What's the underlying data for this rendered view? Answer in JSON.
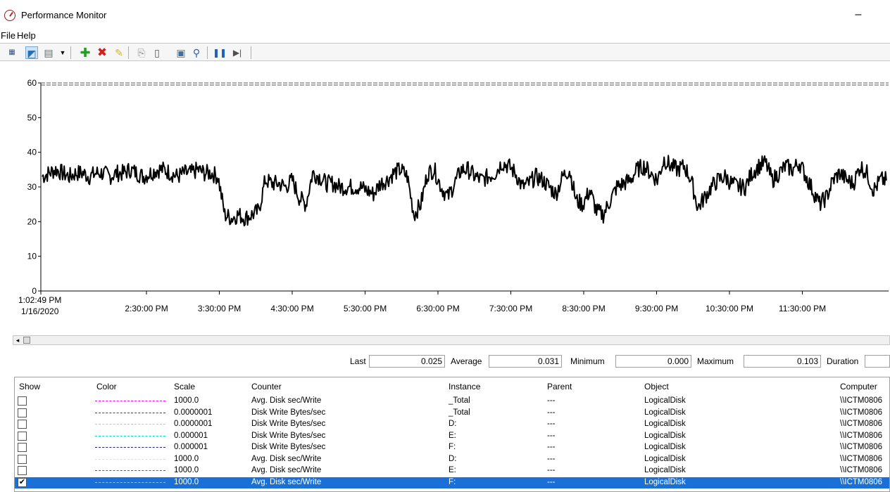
{
  "window": {
    "title": "Performance Monitor",
    "minimize_glyph": "–"
  },
  "menu": [
    "File",
    "Help"
  ],
  "toolbar": {
    "icons": [
      "view-graph-icon",
      "change-graph-type-icon",
      "chart-dropdown-icon",
      "add-counter-icon",
      "delete-counter-icon",
      "highlight-icon",
      "copy-properties-icon",
      "paste-counter-list-icon",
      "properties-icon",
      "zoom-icon",
      "freeze-display-icon",
      "update-data-icon"
    ]
  },
  "chart_data": {
    "type": "line",
    "ylim": [
      0,
      60
    ],
    "yticks": [
      "0",
      "10",
      "20",
      "30",
      "40",
      "50",
      "60"
    ],
    "xticks": [
      {
        "label": "1:02:49 PM",
        "sub": "1/16/2020"
      },
      {
        "label": "2:30:00 PM"
      },
      {
        "label": "3:30:00 PM"
      },
      {
        "label": "4:30:00 PM"
      },
      {
        "label": "5:30:00 PM"
      },
      {
        "label": "6:30:00 PM"
      },
      {
        "label": "7:30:00 PM"
      },
      {
        "label": "8:30:00 PM"
      },
      {
        "label": "9:30:00 PM"
      },
      {
        "label": "10:30:00 PM"
      },
      {
        "label": "11:30:00 PM"
      }
    ],
    "series": [
      {
        "color": "#000000",
        "values": [
          33,
          34,
          35,
          34,
          33,
          34,
          34,
          33,
          34,
          34,
          33,
          34,
          34,
          35,
          34,
          33,
          34,
          35,
          35,
          34,
          33,
          34,
          34,
          35,
          34,
          34,
          33,
          22,
          21,
          22,
          21,
          22,
          23,
          32,
          31,
          31,
          30,
          32,
          27,
          25,
          34,
          33,
          31,
          31,
          30,
          30,
          30,
          30,
          29,
          28,
          31,
          32,
          34,
          35,
          33,
          22,
          25,
          34,
          35,
          30,
          27,
          31,
          35,
          35,
          33,
          32,
          33,
          34,
          37,
          36,
          34,
          30,
          31,
          33,
          32,
          30,
          28,
          33,
          35,
          26,
          25,
          29,
          23,
          22,
          26,
          30,
          31,
          32,
          35,
          36,
          34,
          32,
          38,
          36,
          35,
          36,
          32,
          24,
          27,
          30,
          32,
          33,
          31,
          30,
          30,
          34,
          36,
          37,
          32,
          34,
          36,
          35,
          37,
          33,
          29,
          25,
          27,
          32,
          34,
          32,
          31,
          36,
          34,
          29,
          32
        ]
      }
    ]
  },
  "stats": {
    "last_label": "Last",
    "last_value": "0.025",
    "average_label": "Average",
    "average_value": "0.031",
    "minimum_label": "Minimum",
    "minimum_value": "0.000",
    "maximum_label": "Maximum",
    "maximum_value": "0.103",
    "duration_label": "Duration"
  },
  "legend": {
    "headers": {
      "show": "Show",
      "color": "Color",
      "scale": "Scale",
      "counter": "Counter",
      "instance": "Instance",
      "parent": "Parent",
      "object": "Object",
      "computer": "Computer"
    },
    "rows": [
      {
        "checked": false,
        "color": "#ff00ff",
        "scale": "1000.0",
        "counter": "Avg. Disk sec/Write",
        "instance": "_Total",
        "parent": "---",
        "object": "LogicalDisk",
        "computer": "\\\\ICTM0806"
      },
      {
        "checked": false,
        "color": "#a000a0",
        "scale": "0.0000001",
        "counter": "Disk Write Bytes/sec",
        "instance": "_Total",
        "parent": "---",
        "object": "LogicalDisk",
        "computer": "\\\\ICTM0806"
      },
      {
        "checked": false,
        "color": "#f0d000",
        "scale": "0.0000001",
        "counter": "Disk Write Bytes/sec",
        "instance": "D:",
        "parent": "---",
        "object": "LogicalDisk",
        "computer": "\\\\ICTM0806"
      },
      {
        "checked": false,
        "color": "#00d8e0",
        "scale": "0.000001",
        "counter": "Disk Write Bytes/sec",
        "instance": "E:",
        "parent": "---",
        "object": "LogicalDisk",
        "computer": "\\\\ICTM0806"
      },
      {
        "checked": false,
        "color": "#202080",
        "scale": "0.000001",
        "counter": "Disk Write Bytes/sec",
        "instance": "F:",
        "parent": "---",
        "object": "LogicalDisk",
        "computer": "\\\\ICTM0806"
      },
      {
        "checked": false,
        "color": "#f0e0a0",
        "scale": "1000.0",
        "counter": "Avg. Disk sec/Write",
        "instance": "D:",
        "parent": "---",
        "object": "LogicalDisk",
        "computer": "\\\\ICTM0806"
      },
      {
        "checked": false,
        "color": "#208040",
        "scale": "1000.0",
        "counter": "Avg. Disk sec/Write",
        "instance": "E:",
        "parent": "---",
        "object": "LogicalDisk",
        "computer": "\\\\ICTM0806"
      },
      {
        "checked": true,
        "selected": true,
        "color": "#80c0ff",
        "scale": "1000.0",
        "counter": "Avg. Disk sec/Write",
        "instance": "F:",
        "parent": "---",
        "object": "LogicalDisk",
        "computer": "\\\\ICTM0806"
      }
    ]
  }
}
